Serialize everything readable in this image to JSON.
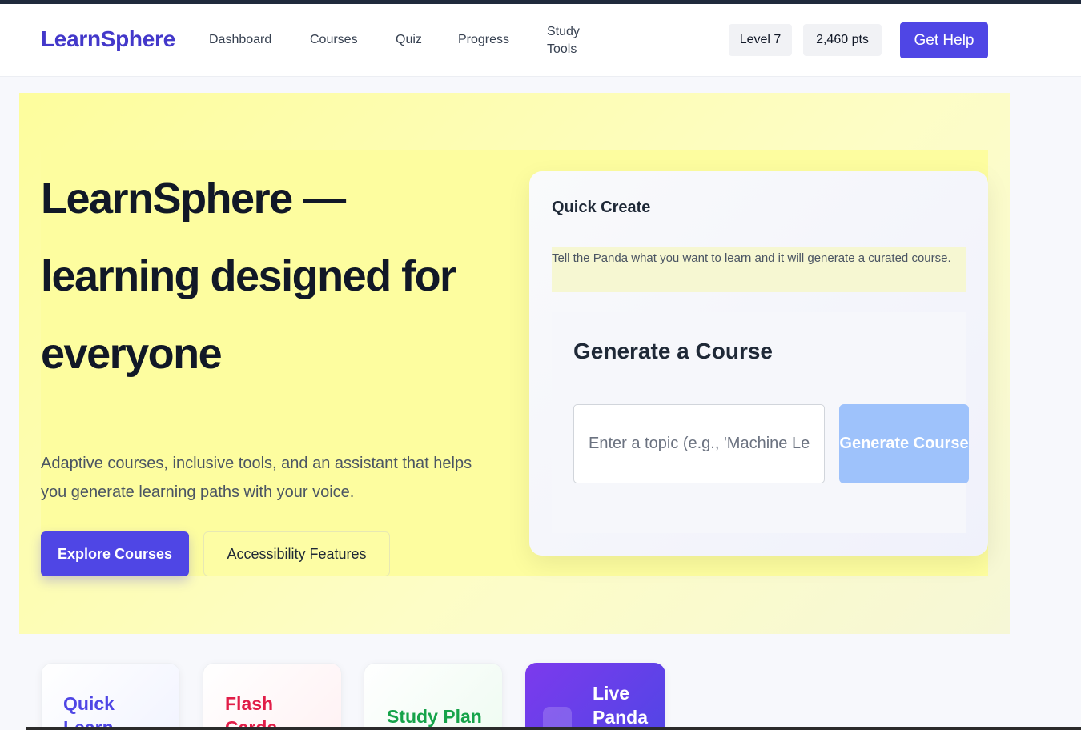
{
  "header": {
    "logo": "LearnSphere",
    "nav": {
      "dashboard": "Dashboard",
      "courses": "Courses",
      "quiz": "Quiz",
      "progress": "Progress",
      "study_tools": "Study Tools"
    },
    "level": "Level 7",
    "points": "2,460 pts",
    "help_label": "Get Help"
  },
  "hero": {
    "title": "LearnSphere — learning designed for everyone",
    "subtitle": "Adaptive courses, inclusive tools, and an assistant that helps you generate learning paths with your voice.",
    "explore_label": "Explore Courses",
    "accessibility_label": "Accessibility Features"
  },
  "quick_create": {
    "title": "Quick Create",
    "description": "Tell the Panda what you want to learn and it will generate a curated course.",
    "generate_title": "Generate a Course",
    "input_placeholder": "Enter a topic (e.g., 'Machine Learning')",
    "input_value": "",
    "generate_label": "Generate Course"
  },
  "features": {
    "quick_learn": "Quick Learn",
    "flash_cards": "Flash Cards",
    "study_plan": "Study Plan",
    "live_panda": "Live Panda"
  },
  "colors": {
    "brand": "#4f46e5",
    "hero_bg": "#fdfd9f",
    "generate_disabled": "#9ec2fb"
  }
}
